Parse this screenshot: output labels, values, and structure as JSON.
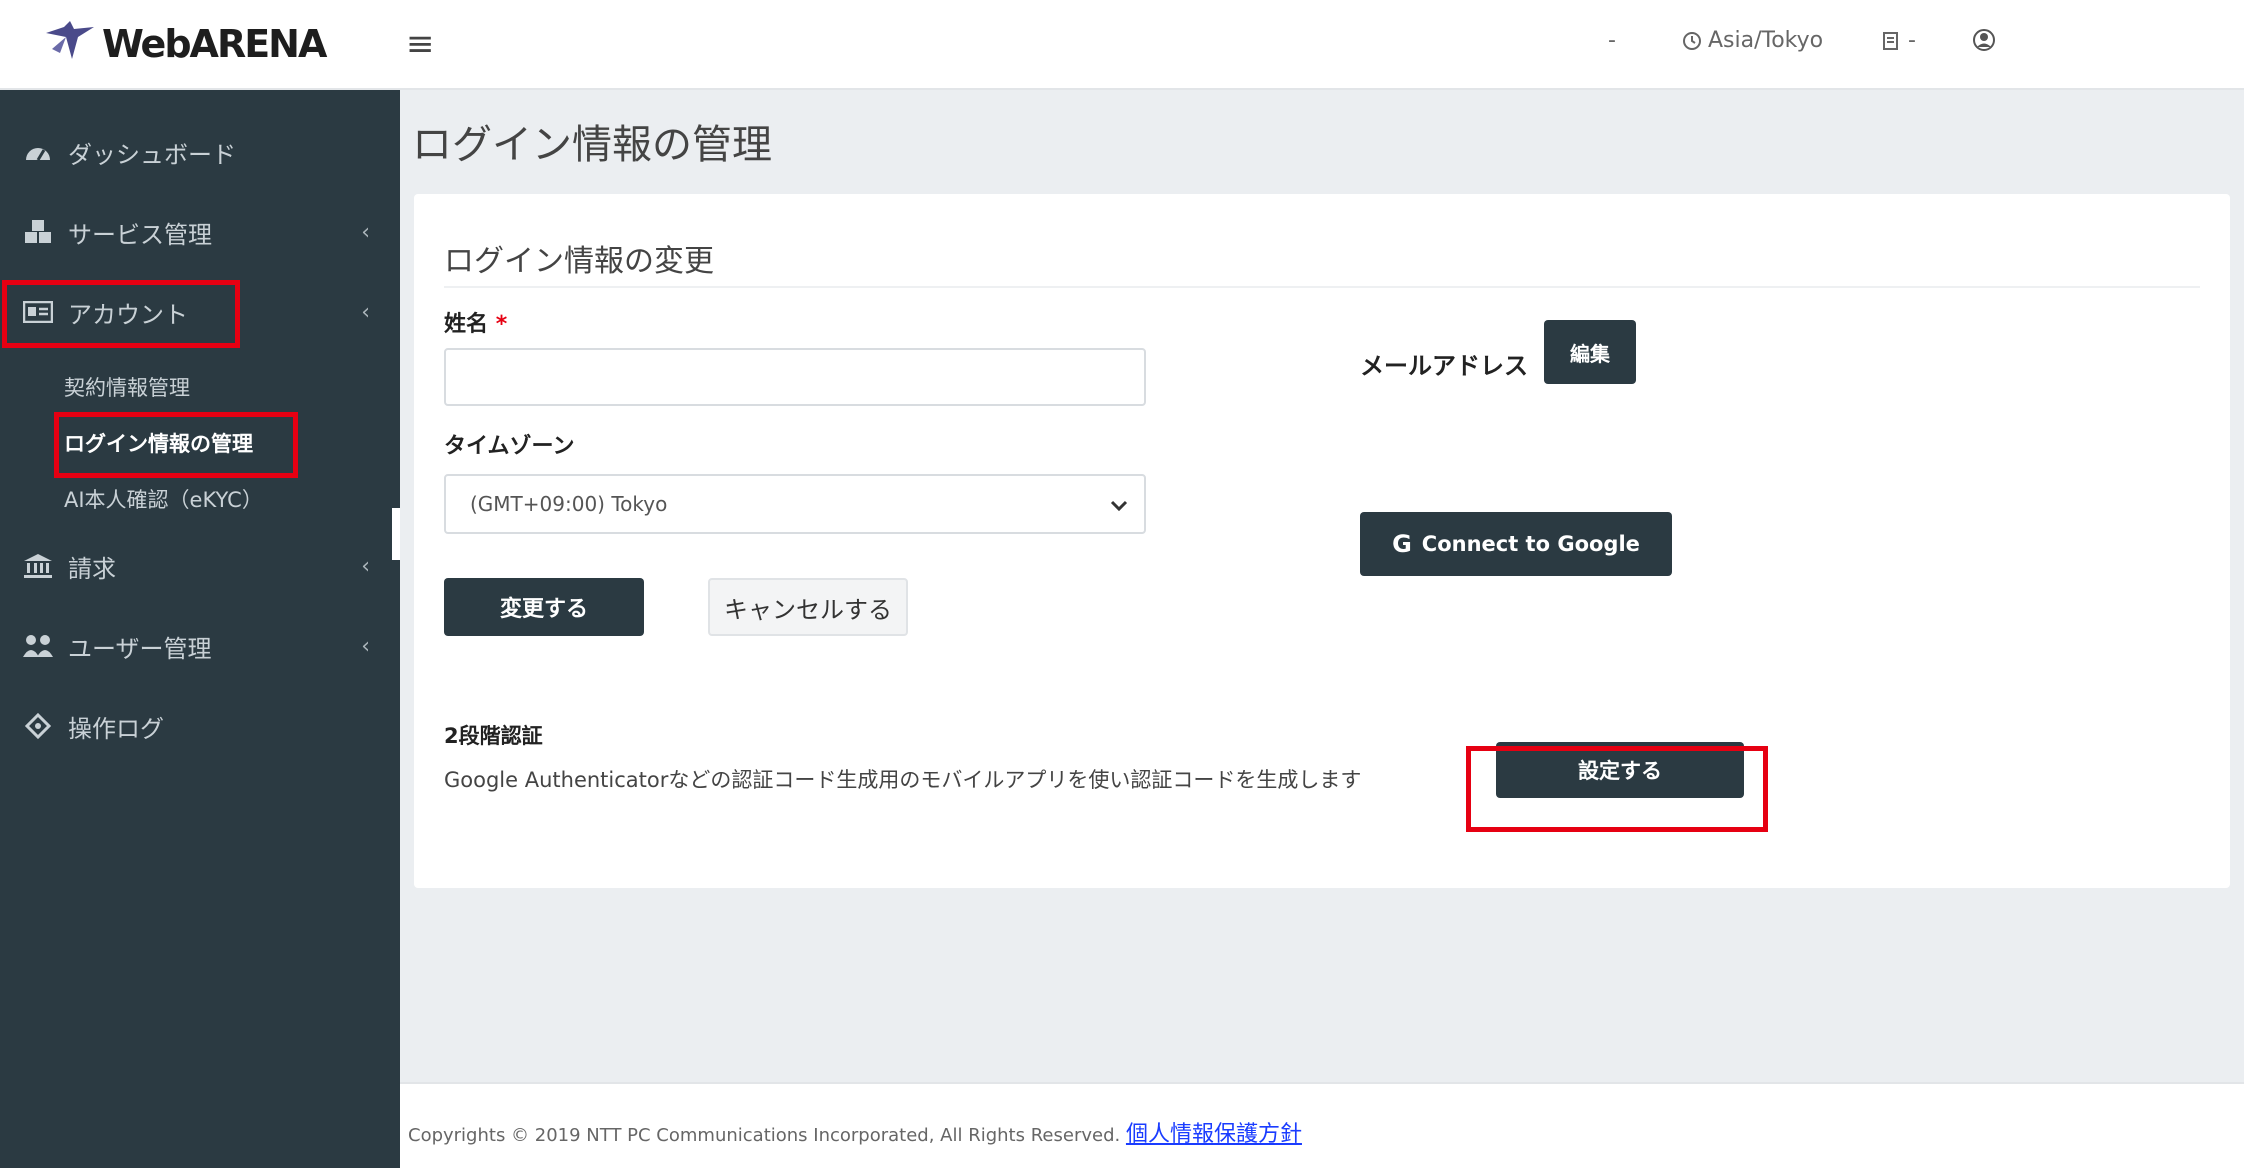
{
  "brand": {
    "logo_text": "WebARENA"
  },
  "header": {
    "menu_icon": "hamburger-icon",
    "dropdown_caret": "-",
    "timezone": "Asia/Tokyo",
    "notification_caret": "-"
  },
  "sidebar": {
    "items": [
      {
        "label": "ダッシュボード",
        "icon": "dashboard-icon"
      },
      {
        "label": "サービス管理",
        "icon": "cubes-icon"
      },
      {
        "label": "アカウント",
        "icon": "id-card-icon"
      },
      {
        "label": "請求",
        "icon": "bank-icon"
      },
      {
        "label": "ユーザー管理",
        "icon": "users-icon"
      },
      {
        "label": "操作ログ",
        "icon": "log-icon"
      }
    ],
    "account_sub": [
      {
        "label": "契約情報管理"
      },
      {
        "label": "ログイン情報の管理"
      },
      {
        "label": "AI本人確認（eKYC）"
      }
    ],
    "chevron": "‹"
  },
  "main": {
    "page_title": "ログイン情報の管理",
    "card_title": "ログイン情報の変更",
    "name_label": "姓名",
    "required_mark": "*",
    "name_value": "",
    "email_label": "メールアドレス",
    "edit_button": "編集",
    "timezone_label": "タイムゾーン",
    "timezone_value": "(GMT+09:00) Tokyo",
    "google_button": "Connect to Google",
    "submit_button": "変更する",
    "cancel_button": "キャンセルする",
    "twofa_label": "2段階認証",
    "twofa_desc": "Google Authenticatorなどの認証コード生成用のモバイルアプリを使い認証コードを生成します",
    "twofa_button": "設定する"
  },
  "footer": {
    "copyright": "Copyrights © 2019 NTT PC Communications Incorporated, All Rights Reserved.",
    "privacy_link": "個人情報保護方針"
  },
  "colors": {
    "sidebar": "#2b3a42",
    "highlight": "#e60012",
    "link": "#1a3cff"
  }
}
